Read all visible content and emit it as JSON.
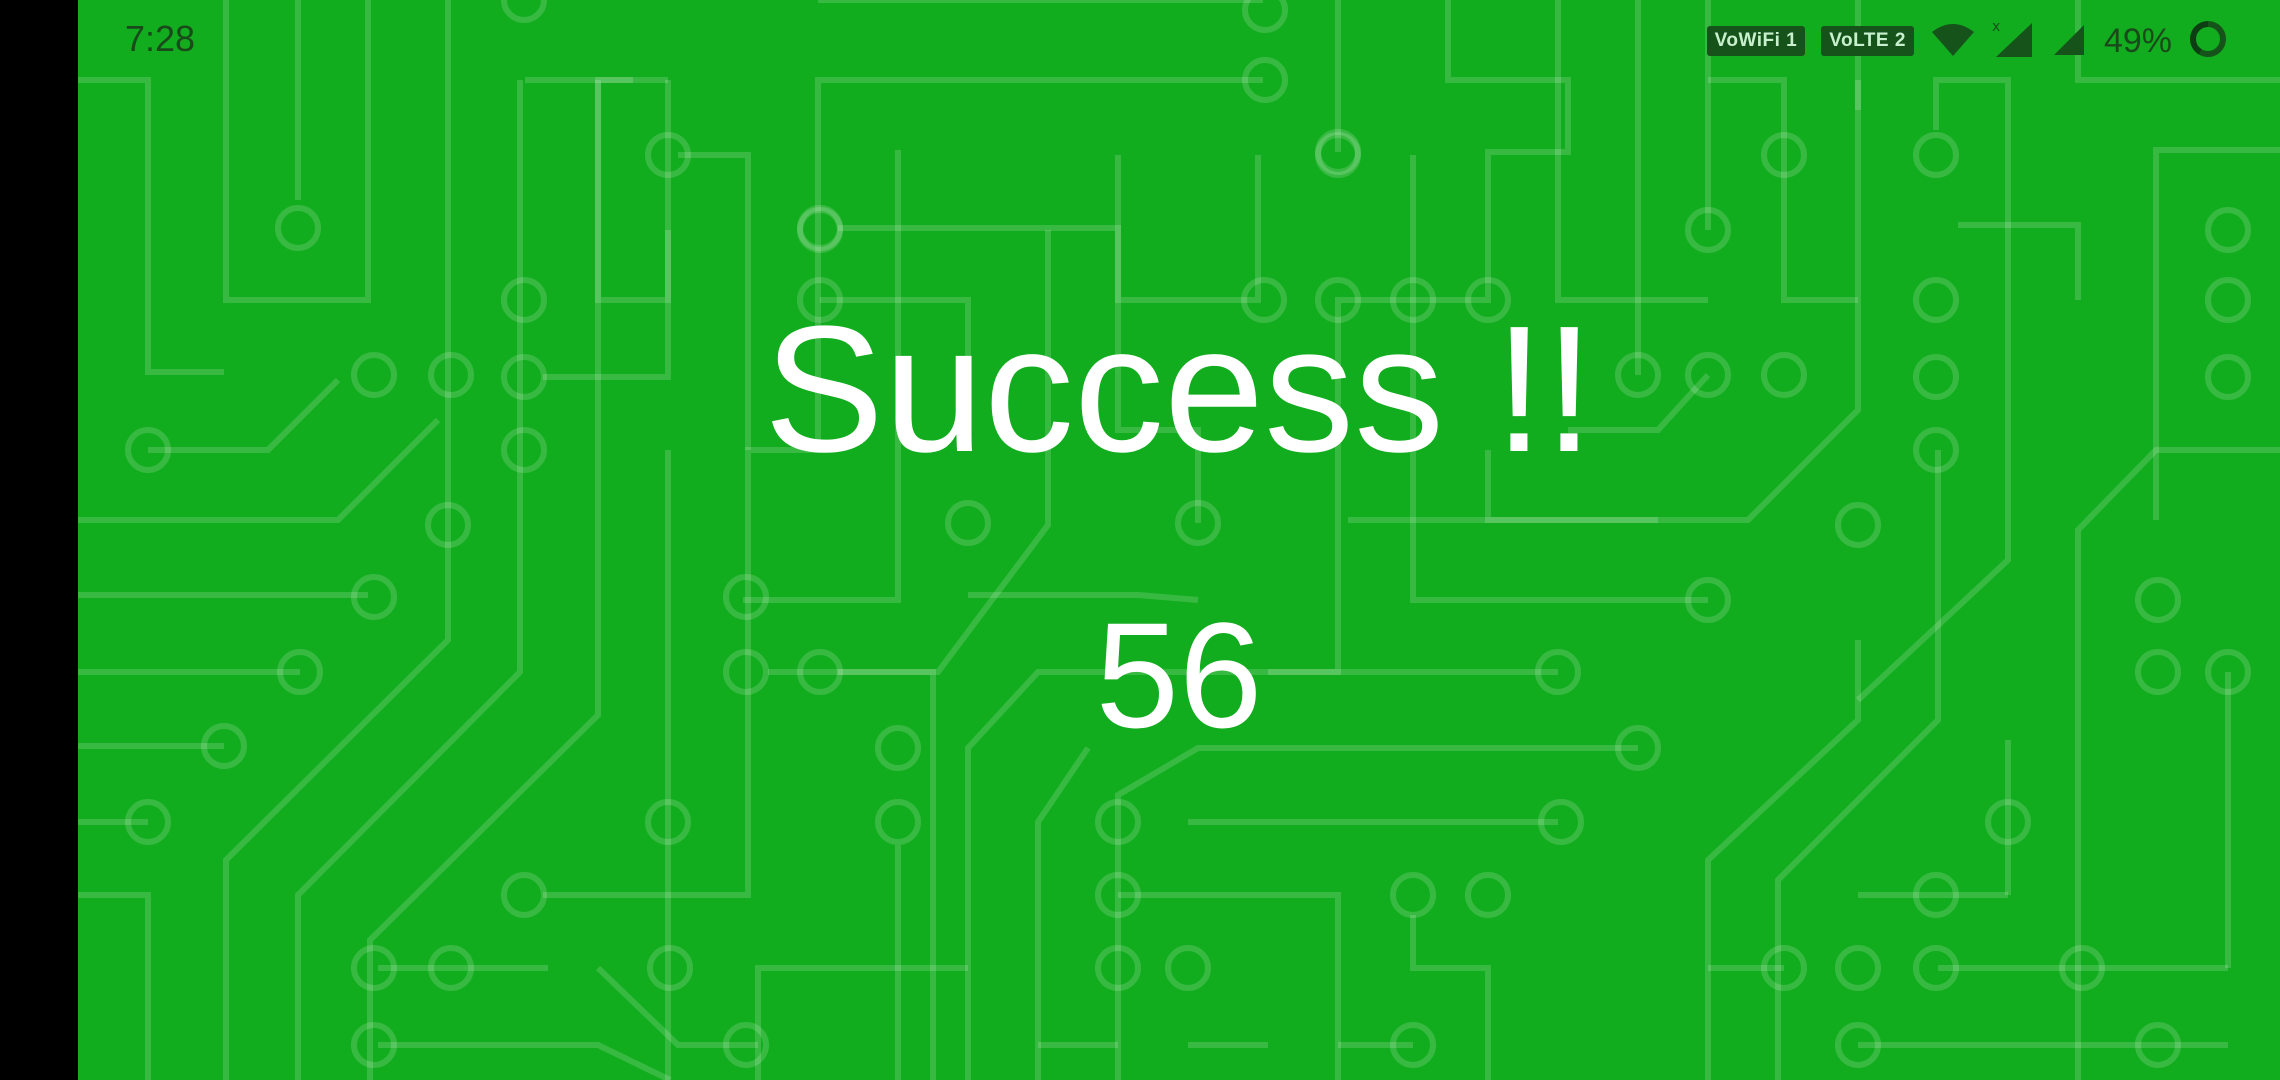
{
  "status_bar": {
    "time": "7:28",
    "badges": [
      "VoWiFi 1",
      "VoLTE 2"
    ],
    "battery_percent": "49%",
    "icons": [
      "wifi-icon",
      "signal-icon",
      "signal-icon",
      "battery-icon"
    ]
  },
  "game": {
    "headline": "Success !!",
    "score": "56"
  },
  "colors": {
    "background": "#12ad1e",
    "text": "#ffffff",
    "status_text": "#1a4a1c"
  }
}
